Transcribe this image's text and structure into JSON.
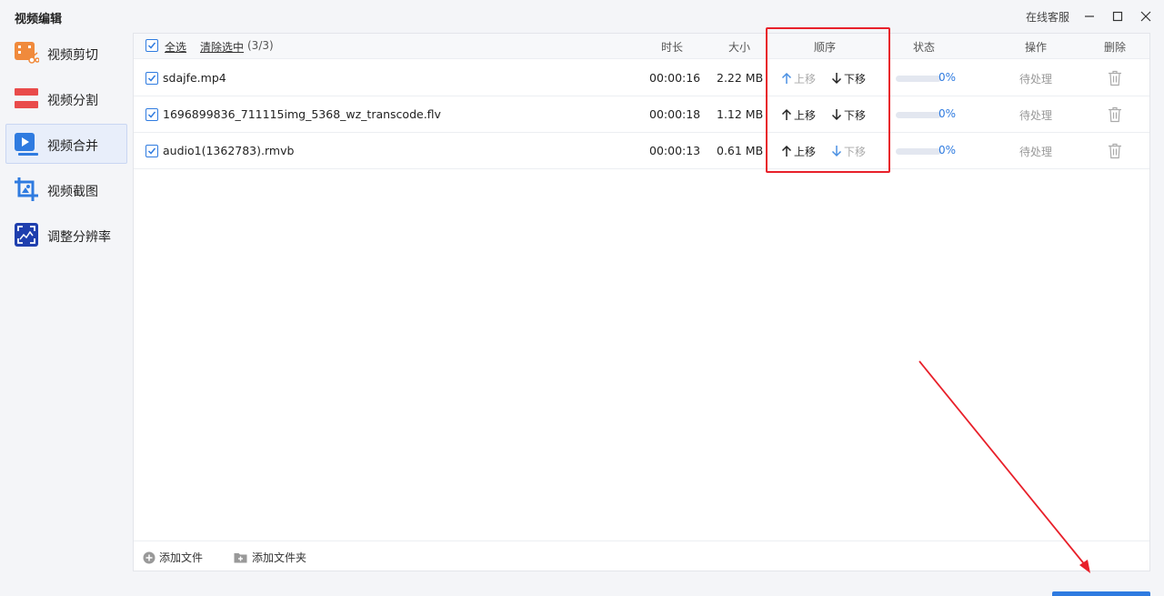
{
  "app": {
    "title": "视频编辑",
    "customer_service": "在线客服"
  },
  "sidebar": {
    "items": [
      {
        "label": "视频剪切",
        "icon": "scissors-video-icon"
      },
      {
        "label": "视频分割",
        "icon": "split-icon"
      },
      {
        "label": "视频合并",
        "icon": "merge-icon"
      },
      {
        "label": "视频截图",
        "icon": "crop-screenshot-icon"
      },
      {
        "label": "调整分辨率",
        "icon": "resolution-icon"
      }
    ],
    "active_index": 2
  },
  "table": {
    "select_all": "全选",
    "clear_selection": "清除选中",
    "selection_count": "(3/3)",
    "columns": {
      "duration": "时长",
      "size": "大小",
      "order": "顺序",
      "status": "状态",
      "action": "操作",
      "delete": "删除"
    },
    "move_up": "上移",
    "move_down": "下移",
    "rows": [
      {
        "name": "sdajfe.mp4",
        "duration": "00:00:16",
        "size": "2.22 MB",
        "progress": "0%",
        "status": "待处理",
        "up_enabled": false,
        "down_enabled": true
      },
      {
        "name": "1696899836_711115img_5368_wz_transcode.flv",
        "duration": "00:00:18",
        "size": "1.12 MB",
        "progress": "0%",
        "status": "待处理",
        "up_enabled": true,
        "down_enabled": true
      },
      {
        "name": "audio1(1362783).rmvb",
        "duration": "00:00:13",
        "size": "0.61 MB",
        "progress": "0%",
        "status": "待处理",
        "up_enabled": true,
        "down_enabled": false
      }
    ]
  },
  "footer": {
    "add_file": "添加文件",
    "add_folder": "添加文件夹"
  },
  "colors": {
    "accent": "#2f7be0",
    "annotation": "#e8202a"
  }
}
